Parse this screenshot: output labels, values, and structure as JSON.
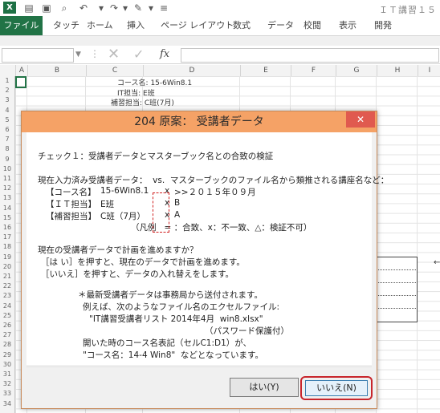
{
  "titlebar": {
    "app_logo": "X",
    "doc_title": "ＩＴ講習１５",
    "qat_icons": [
      "save-icon",
      "open-icon",
      "print-preview-icon",
      "undo-icon",
      "redo-icon",
      "brush-icon",
      "customize-icon"
    ]
  },
  "ribbon": {
    "tabs": [
      "ファイル",
      "タッチ",
      "ホーム",
      "挿入",
      "ページ レイアウト",
      "数式",
      "データ",
      "校閲",
      "表示",
      "開発"
    ]
  },
  "formula_bar": {
    "fx_label": "fx",
    "cancel": "✕",
    "enter": "✓"
  },
  "sheet": {
    "columns": [
      "A",
      "B",
      "C",
      "D",
      "E",
      "F",
      "G",
      "H",
      "I"
    ],
    "rows": [
      "1",
      "2",
      "3",
      "4",
      "5",
      "6",
      "7",
      "8",
      "9",
      "10",
      "11",
      "12",
      "13",
      "14",
      "15",
      "16",
      "17",
      "18",
      "19",
      "20",
      "21",
      "22",
      "23",
      "24",
      "25",
      "26",
      "27",
      "28",
      "29",
      "30",
      "31",
      "32",
      "33",
      "34"
    ],
    "cells": {
      "c1": "コース名:  15-6Win8.1",
      "c2": "IT担当:  E班",
      "c3": "補習担当:  C班(7月)"
    }
  },
  "dialog": {
    "title": "204 原案： 受講者データ",
    "close": "✕",
    "check_line": "チェック１：受講者データとマスターブック名との合致の検証",
    "compare_line": "現在入力済み受講者データ：  vs.  マスターブックのファイル名から類推される講座名など：",
    "rows": [
      {
        "label": "【コース名】",
        "value": "15-6Win8.1",
        "mark": "x",
        "target": ">>２０１５年０９月"
      },
      {
        "label": "【ＩＴ担当】",
        "value": "E班",
        "mark": "x",
        "target": "B"
      },
      {
        "label": "【補習担当】",
        "value": "C班（7月）",
        "mark": "x",
        "target": "A"
      }
    ],
    "legend": "（凡例   = ：合致、x：不一致、△：検証不可）",
    "question": "現在の受講者データで計画を進めますか？",
    "yes_hint": "［は い］を押すと、現在のデータで計画を進めます。",
    "no_hint": "［いいえ］を押すと、データの入れ替えをします。",
    "note1": "＊最新受講者データは事務局から送付されます。",
    "note2": "例えば、次のようなファイル名のエクセルファイル:",
    "note3": "\"IT講習受講者リスト 2014年4月  win8.xlsx\"",
    "note4": "（パスワード保護付）",
    "note5": "開いた時のコース名表記（セルC1:D1）が、",
    "note6": "\"コース名：14-4 Win8\"  などとなっています。",
    "yes_label": "はい(Y)",
    "no_label": "いいえ(N)"
  },
  "colors": {
    "excel_green": "#217346",
    "dialog_title": "#f5a266",
    "close_red": "#e05a4f",
    "highlight_red": "#c8262c"
  }
}
